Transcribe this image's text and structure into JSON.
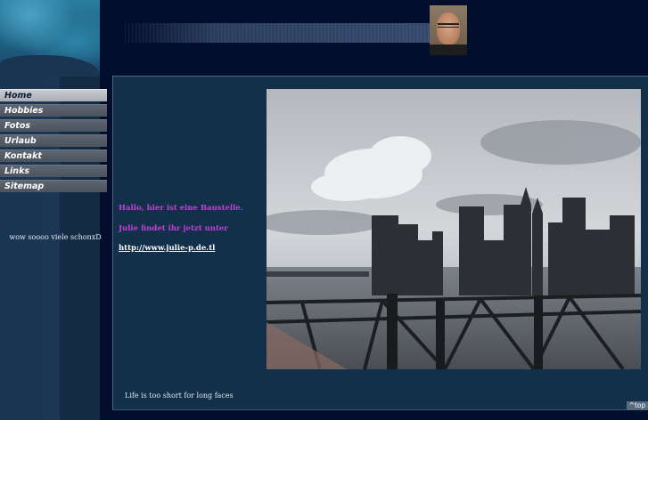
{
  "nav": {
    "items": [
      {
        "label": "Home",
        "active": true
      },
      {
        "label": "Hobbies",
        "active": false
      },
      {
        "label": "Fotos",
        "active": false
      },
      {
        "label": "Urlaub",
        "active": false
      },
      {
        "label": "Kontakt",
        "active": false
      },
      {
        "label": "Links",
        "active": false
      },
      {
        "label": "Sitemap",
        "active": false
      }
    ]
  },
  "sidebar": {
    "note": "wow soooo viele schonxD"
  },
  "content": {
    "message_1": "Hallo, hier ist eine Baustelle.",
    "message_2": "Julie findet ihr jetzt unter",
    "link_text": "http://www.julie-p.de.tl"
  },
  "footer": {
    "quote": "Life is too short for long faces",
    "top_link": "^top"
  },
  "colors": {
    "page_background": "#020e2c",
    "panel": "#12304a",
    "sidebar": "#1a3552",
    "message_text": "#c63fd6",
    "nav_active": "#b9bcc1",
    "nav_inactive": "#555d68"
  },
  "images": {
    "avatar": "man-with-glasses-portrait",
    "photo": "manhattan-skyline-from-brooklyn-bridge"
  }
}
